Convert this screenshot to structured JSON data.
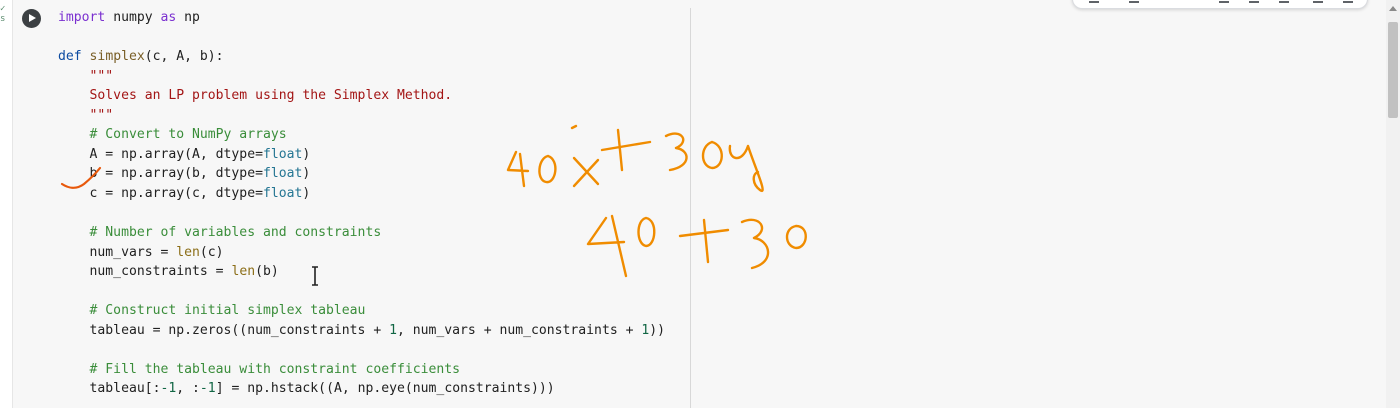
{
  "gutter": {
    "mark": "✓\ns"
  },
  "cell": {
    "run_button_icon": "play-icon",
    "code_lines": [
      [
        {
          "t": "kw",
          "v": "import"
        },
        {
          "t": "ident",
          "v": " numpy "
        },
        {
          "t": "kw",
          "v": "as"
        },
        {
          "t": "ident",
          "v": " np"
        }
      ],
      [],
      [
        {
          "t": "kb",
          "v": "def"
        },
        {
          "t": "ident",
          "v": " "
        },
        {
          "t": "fn",
          "v": "simplex"
        },
        {
          "t": "ident",
          "v": "(c, A, b):"
        }
      ],
      [
        {
          "t": "str",
          "v": "    \"\"\""
        }
      ],
      [
        {
          "t": "str",
          "v": "    Solves an LP problem using the Simplex Method."
        }
      ],
      [
        {
          "t": "str",
          "v": "    \"\"\""
        }
      ],
      [
        {
          "t": "cm",
          "v": "    # Convert to NumPy arrays"
        }
      ],
      [
        {
          "t": "ident",
          "v": "    A = np.array(A, dtype="
        },
        {
          "t": "ty",
          "v": "float"
        },
        {
          "t": "ident",
          "v": ")"
        }
      ],
      [
        {
          "t": "ident",
          "v": "    b = np.array(b, dtype="
        },
        {
          "t": "ty",
          "v": "float"
        },
        {
          "t": "ident",
          "v": ")"
        }
      ],
      [
        {
          "t": "ident",
          "v": "    c = np.array(c, dtype="
        },
        {
          "t": "ty",
          "v": "float"
        },
        {
          "t": "ident",
          "v": ")"
        }
      ],
      [],
      [
        {
          "t": "cm",
          "v": "    # Number of variables and constraints"
        }
      ],
      [
        {
          "t": "ident",
          "v": "    num_vars = "
        },
        {
          "t": "bi",
          "v": "len"
        },
        {
          "t": "ident",
          "v": "(c)"
        }
      ],
      [
        {
          "t": "ident",
          "v": "    num_constraints = "
        },
        {
          "t": "bi",
          "v": "len"
        },
        {
          "t": "ident",
          "v": "(b)"
        }
      ],
      [],
      [
        {
          "t": "cm",
          "v": "    # Construct initial simplex tableau"
        }
      ],
      [
        {
          "t": "ident",
          "v": "    tableau = np.zeros((num_constraints + "
        },
        {
          "t": "num",
          "v": "1"
        },
        {
          "t": "ident",
          "v": ", num_vars + num_constraints + "
        },
        {
          "t": "num",
          "v": "1"
        },
        {
          "t": "ident",
          "v": "))"
        }
      ],
      [],
      [
        {
          "t": "cm",
          "v": "    # Fill the tableau with constraint coefficients"
        }
      ],
      [
        {
          "t": "ident",
          "v": "    tableau[:"
        },
        {
          "t": "num",
          "v": "-1"
        },
        {
          "t": "ident",
          "v": ", :"
        },
        {
          "t": "num",
          "v": "-1"
        },
        {
          "t": "ident",
          "v": "] = np.hstack((A, np.eye(num_constraints)))"
        }
      ]
    ]
  },
  "annotations": {
    "ink_color": "#f08c00",
    "check_color": "#e8590c",
    "handwriting_line1": "40x+30y",
    "handwriting_line2": "40 +30"
  }
}
